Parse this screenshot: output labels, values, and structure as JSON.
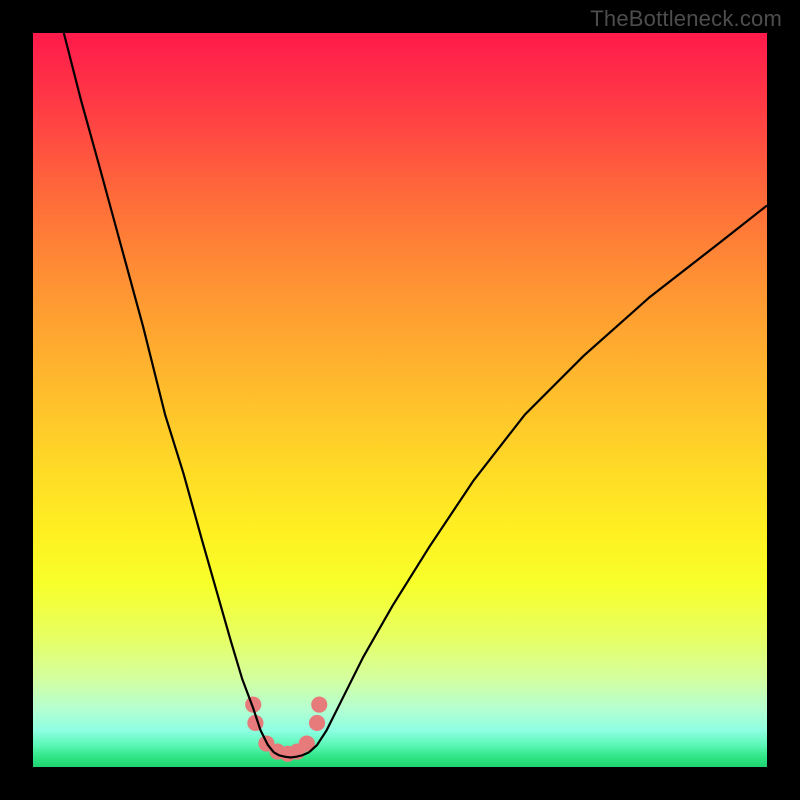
{
  "watermark": "TheBottleneck.com",
  "colors": {
    "frame": "#000000",
    "curve_stroke": "#000000",
    "dot_fill": "#e77b7b",
    "gradient_top": "#ff1a4b",
    "gradient_bottom": "#1ed36e"
  },
  "chart_data": {
    "type": "line",
    "title": "",
    "xlabel": "",
    "ylabel": "",
    "xlim": [
      0,
      100
    ],
    "ylim": [
      0,
      100
    ],
    "grid": false,
    "note": "Axes unlabeled in source; values are estimated pixel-percent positions (0=left/bottom, 100=right/top).",
    "series": [
      {
        "name": "left-curve",
        "x": [
          4.2,
          6.5,
          9,
          12,
          15,
          18,
          20.5,
          23,
          25,
          27,
          28.5,
          30,
          31,
          32,
          32.8
        ],
        "values": [
          100,
          91,
          82,
          71,
          60,
          48,
          40,
          31,
          24,
          17,
          12,
          8,
          5,
          3,
          2
        ]
      },
      {
        "name": "right-curve",
        "x": [
          37.6,
          38.7,
          40,
          42,
          45,
          49,
          54,
          60,
          67,
          75,
          84,
          93,
          100
        ],
        "values": [
          2,
          3,
          5,
          9,
          15,
          22,
          30,
          39,
          48,
          56,
          64,
          71,
          76.5
        ]
      },
      {
        "name": "valley-floor",
        "x": [
          32.8,
          33.5,
          34.3,
          35.1,
          35.9,
          36.7,
          37.6
        ],
        "values": [
          2,
          1.6,
          1.4,
          1.3,
          1.4,
          1.6,
          2
        ]
      }
    ],
    "dots": {
      "name": "highlight-dots",
      "x": [
        30.0,
        30.3,
        31.8,
        33.3,
        34.7,
        36.0,
        37.3,
        38.7,
        39.0
      ],
      "values": [
        8.5,
        6.0,
        3.2,
        2.1,
        1.8,
        2.1,
        3.2,
        6.0,
        8.5
      ],
      "radius_pct": 1.1
    }
  }
}
